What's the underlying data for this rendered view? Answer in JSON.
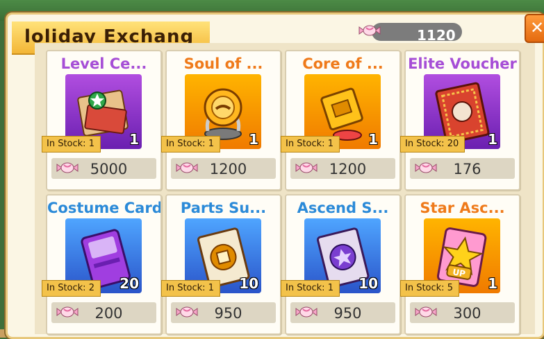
{
  "header": {
    "title": "Holiday Exchange",
    "title_visible": "loliday Exchang",
    "currency_amount": "1120",
    "currency_icon": "candy-icon"
  },
  "items": [
    {
      "name": "Level Ce...",
      "qty": "1",
      "stock": "In Stock: 1",
      "price": "5000",
      "icon": "level-certificate-book-icon",
      "name_color": "#a64ed6",
      "bg": "purple"
    },
    {
      "name": "Soul of ...",
      "qty": "1",
      "stock": "In Stock: 1",
      "price": "1200",
      "icon": "soul-orb-icon",
      "name_color": "#ef7a1a",
      "bg": "orange"
    },
    {
      "name": "Core of ...",
      "qty": "1",
      "stock": "In Stock: 1",
      "price": "1200",
      "icon": "core-cube-icon",
      "name_color": "#ef7a1a",
      "bg": "orange"
    },
    {
      "name": "Elite Voucher",
      "qty": "1",
      "stock": "In Stock: 20",
      "price": "176",
      "icon": "fist-voucher-icon",
      "name_color": "#a64ed6",
      "bg": "purple"
    },
    {
      "name": "Costume Card",
      "qty": "20",
      "stock": "In Stock: 2",
      "price": "200",
      "icon": "costume-card-icon",
      "name_color": "#2b8ad8",
      "bg": "blue"
    },
    {
      "name": "Parts Su...",
      "qty": "10",
      "stock": "In Stock: 1",
      "price": "950",
      "icon": "parts-scroll-icon",
      "name_color": "#2b8ad8",
      "bg": "blue"
    },
    {
      "name": "Ascend S...",
      "qty": "10",
      "stock": "In Stock: 1",
      "price": "950",
      "icon": "ascend-scroll-icon",
      "name_color": "#2b8ad8",
      "bg": "blue"
    },
    {
      "name": "Star Asc...",
      "qty": "1",
      "stock": "In Stock: 5",
      "price": "300",
      "icon": "star-up-icon",
      "name_color": "#ef7a1a",
      "bg": "orange"
    }
  ]
}
